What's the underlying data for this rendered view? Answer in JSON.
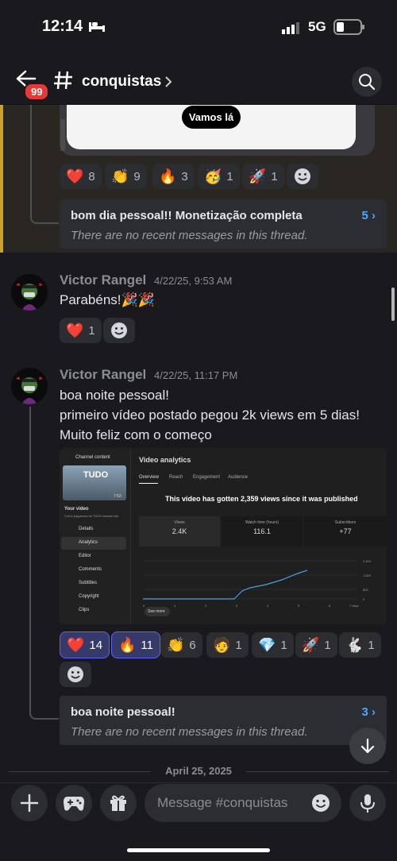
{
  "status": {
    "time": "12:14",
    "network": "5G"
  },
  "header": {
    "back_badge": "99",
    "channel": "conquistas"
  },
  "top_embed": {
    "button_label": "Vamos lá"
  },
  "top_reactions": [
    {
      "emoji": "❤️",
      "count": "8"
    },
    {
      "emoji": "👏",
      "count": "9"
    },
    {
      "emoji": "🔥",
      "count": "3"
    },
    {
      "emoji": "🥳",
      "count": "1"
    },
    {
      "emoji": "🚀",
      "count": "1"
    }
  ],
  "thread1": {
    "title": "bom dia pessoal!! Monetização completa",
    "count": "5",
    "subtitle": "There are no recent messages in this thread."
  },
  "message1": {
    "author": "Victor Rangel",
    "timestamp": "4/22/25, 9:53 AM",
    "text": "Parabéns!🎉🎉",
    "reactions": [
      {
        "emoji": "❤️",
        "count": "1"
      }
    ]
  },
  "message2": {
    "author": "Victor Rangel",
    "timestamp": "4/22/25, 11:17 PM",
    "lines": [
      "boa noite pessoal!",
      "primeiro vídeo postado pegou 2k views em 5 dias!",
      "Muito feliz com o começo"
    ],
    "reactions": [
      {
        "emoji": "❤️",
        "count": "14"
      },
      {
        "emoji": "🔥",
        "count": "11"
      },
      {
        "emoji": "👏",
        "count": "6"
      },
      {
        "emoji": "🧑",
        "count": "1"
      },
      {
        "emoji": "💎",
        "count": "1"
      },
      {
        "emoji": "🚀",
        "count": "1"
      },
      {
        "emoji": "🐇",
        "count": "1"
      }
    ]
  },
  "analytics": {
    "side_title": "Channel content",
    "thumb_text": "TUDO",
    "thumb_duration": "7:53",
    "your_video": "Your video",
    "video_sub": "Como paguenos do TUDO acesse isto",
    "menu": [
      "Details",
      "Analytics",
      "Editor",
      "Comments",
      "Subtitles",
      "Copyright",
      "Clips"
    ],
    "title": "Video analytics",
    "tabs": [
      "Overview",
      "Reach",
      "Engagement",
      "Audience"
    ],
    "headline": "This video has gotten 2,359 views since it was published",
    "stats": [
      {
        "label": "Views",
        "value": "2.4K"
      },
      {
        "label": "Watch time (hours)",
        "value": "116.1"
      },
      {
        "label": "Subscribers",
        "value": "+77"
      }
    ],
    "y_ticks": [
      "2,400",
      "1,600",
      "800",
      "0"
    ],
    "x_ticks": [
      "0",
      "1",
      "2",
      "3",
      "4",
      "5",
      "6",
      "7 days"
    ],
    "see_more": "See more"
  },
  "thread2": {
    "title": "boa noite pessoal!",
    "count": "3",
    "subtitle": "There are no recent messages in this thread."
  },
  "date_divider": "April 25, 2025",
  "composer": {
    "placeholder": "Message #conquistas"
  }
}
